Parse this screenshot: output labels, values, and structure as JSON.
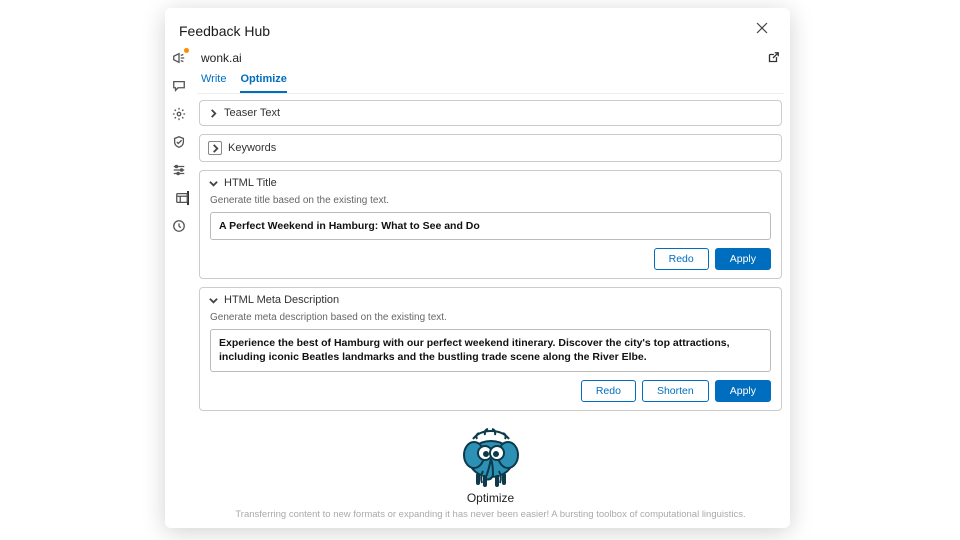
{
  "header": {
    "title": "Feedback Hub"
  },
  "brand": "wonk.ai",
  "tabs": {
    "write": "Write",
    "optimize": "Optimize"
  },
  "panels": {
    "teaser": {
      "title": "Teaser Text"
    },
    "keywords": {
      "title": "Keywords"
    },
    "htmlTitle": {
      "title": "HTML Title",
      "caption": "Generate title based on the existing text.",
      "value": "A Perfect Weekend in Hamburg: What to See and Do",
      "redo": "Redo",
      "apply": "Apply"
    },
    "metaDesc": {
      "title": "HTML Meta Description",
      "caption": "Generate meta description based on the existing text.",
      "value": "Experience the best of Hamburg with our perfect weekend itinerary. Discover the city's top attractions, including iconic Beatles landmarks and the bustling trade scene along the River Elbe.",
      "redo": "Redo",
      "shorten": "Shorten",
      "apply": "Apply"
    }
  },
  "footer": {
    "label": "Optimize",
    "tagline": "Transferring content to new formats or expanding it has never been easier! A bursting toolbox of computational linguistics."
  }
}
